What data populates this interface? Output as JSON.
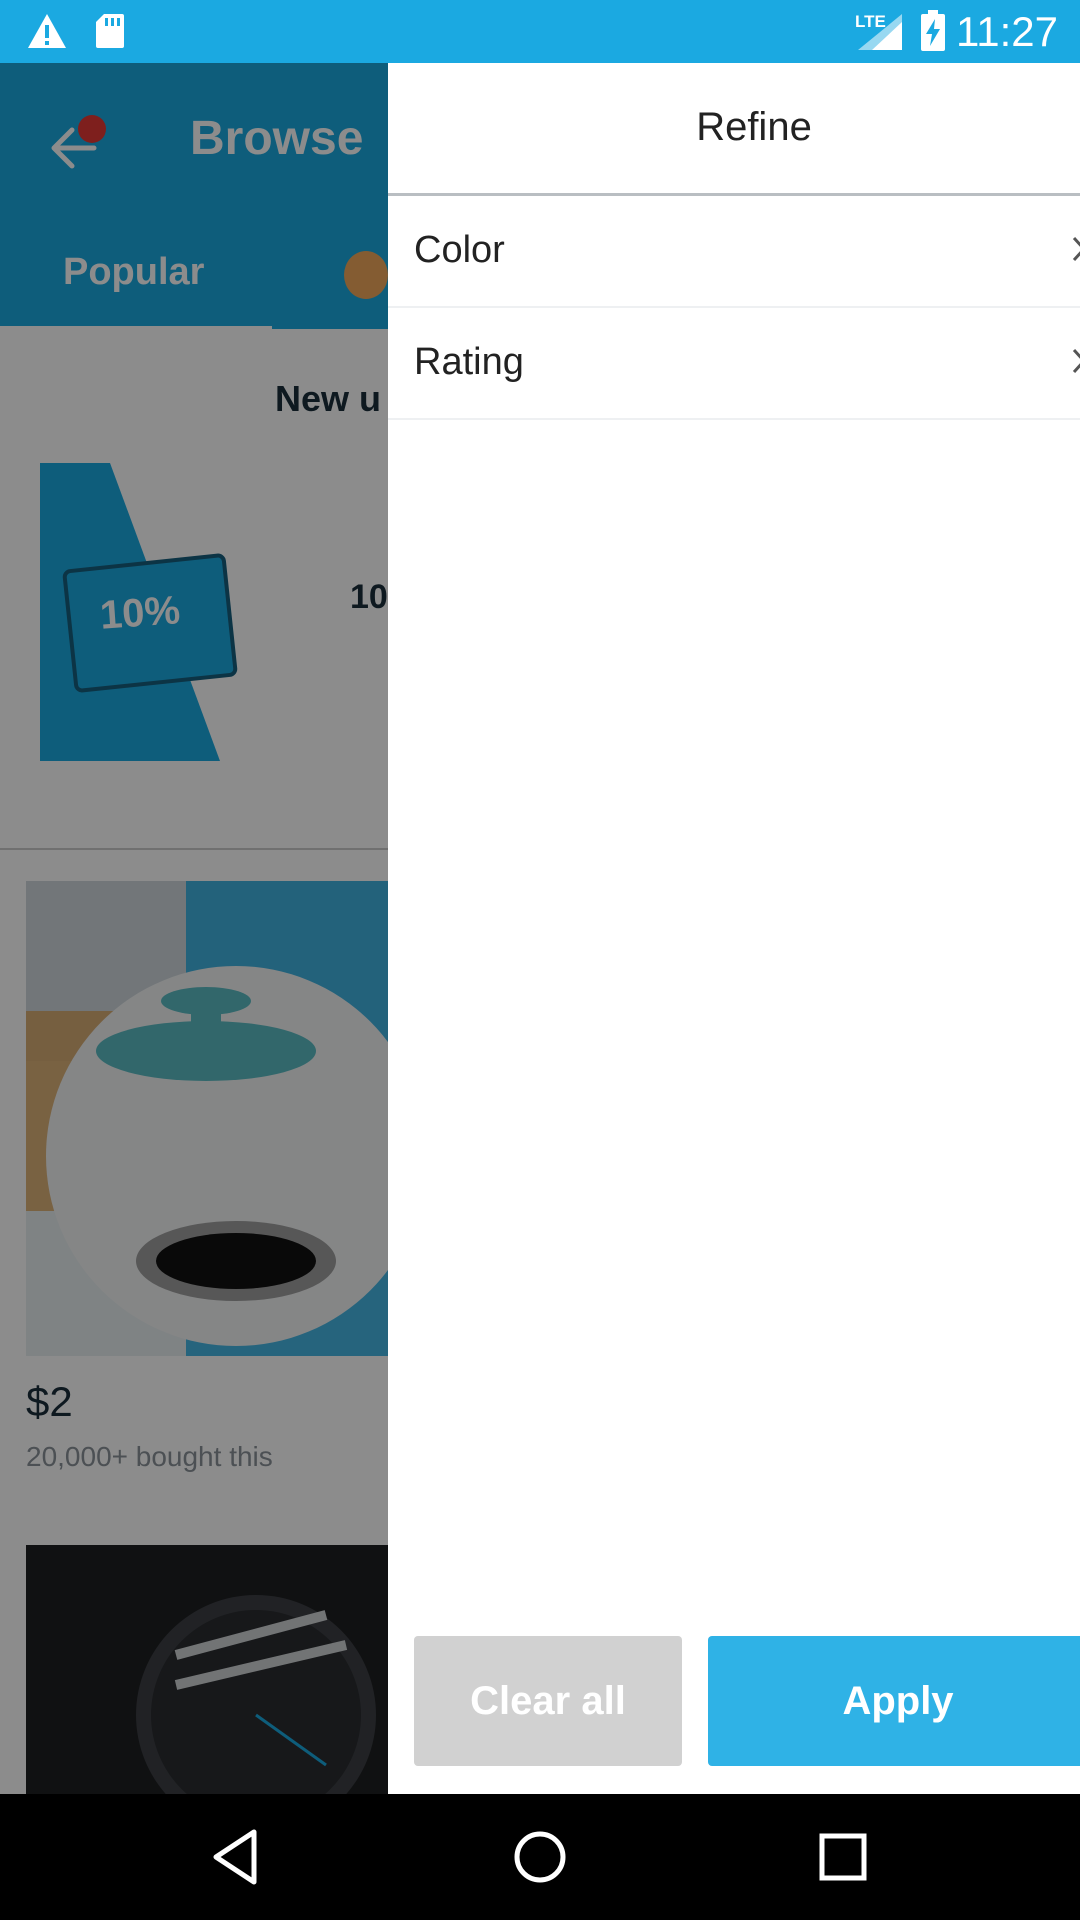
{
  "status_bar": {
    "time": "11:27",
    "network": "LTE",
    "icons": [
      "warning-icon",
      "sd-card-icon",
      "signal-icon",
      "battery-charging-icon"
    ]
  },
  "background_app": {
    "title": "Browse",
    "tab_label": "Popular",
    "promo_title": "New u",
    "coupon_text": "10%",
    "promo_pct": "10",
    "price": "$2",
    "bought": "20,000+ bought this"
  },
  "drawer": {
    "title": "Refine",
    "filters": [
      {
        "label": "Color"
      },
      {
        "label": "Rating"
      }
    ],
    "clear_label": "Clear all",
    "apply_label": "Apply"
  },
  "colors": {
    "accent": "#1ba9e1",
    "apply": "#2fb2e6",
    "clear": "#d1d1d1"
  }
}
